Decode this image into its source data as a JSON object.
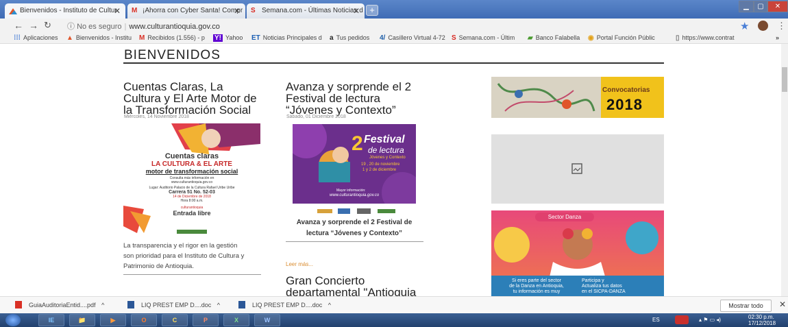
{
  "tabs": [
    {
      "title": "Bienvenidos - Instituto de Cultur",
      "icon": "cultura-favicon-icon",
      "active": true
    },
    {
      "title": "¡Ahorra con Cyber Santa! Compr",
      "icon": "gmail-icon",
      "active": false
    },
    {
      "title": "Semana.com - Últimas Noticias d",
      "icon": "semana-icon",
      "active": false
    }
  ],
  "new_tab_label": "+",
  "toolbar": {
    "security_label": "No es seguro",
    "url": "www.culturantioquia.gov.co"
  },
  "bookmarks": [
    {
      "label": "Aplicaciones",
      "icon": "apps-grid-icon"
    },
    {
      "label": "Bienvenidos - Institu",
      "icon": "cultura-favicon-icon"
    },
    {
      "label": "Recibidos (1.556) - p",
      "icon": "gmail-icon"
    },
    {
      "label": "Yahoo",
      "icon": "yahoo-icon"
    },
    {
      "label": "Noticias Principales d",
      "icon": "et-icon"
    },
    {
      "label": "Tus pedidos",
      "icon": "amazon-icon"
    },
    {
      "label": "Casillero Virtual 4-72",
      "icon": "472-icon"
    },
    {
      "label": "Semana.com - Últim",
      "icon": "semana-icon"
    },
    {
      "label": "Banco Falabella",
      "icon": "falabella-icon"
    },
    {
      "label": "Portal Función Públic",
      "icon": "funcion-publica-icon"
    },
    {
      "label": "https://www.contrat",
      "icon": "page-icon"
    }
  ],
  "page": {
    "heading": "BIENVENIDOS",
    "article1": {
      "title_lines": [
        "Cuentas Claras, La",
        "Cultura y El Arte Motor de",
        "la Transformación Social"
      ],
      "date": "Miércoles, 14 Noviembre 2018",
      "poster": {
        "line1": "Cuentas claras",
        "line2": "LA CULTURA & EL ARTE",
        "line3": "motor de transformación social",
        "line4": "Consulta más información en",
        "line5": "www.culturantioquia.gov.co",
        "line6": "Lugar: Auditorio Palacio de la Cultura Rafael Uribe Uribe",
        "line7": "Carrera 51 No. 52-03",
        "line8": "14 de Diciembre de 2018",
        "line9": "Hora 8:00 a.m.",
        "line10": "culturantioquia",
        "line11": "Entrada libre"
      },
      "body_lines": [
        "La transparencia y el rigor en la gestión",
        "son prioridad para el Instituto de Cultura y",
        "Patrimonio de Antioquia."
      ]
    },
    "article2": {
      "title_lines": [
        "Avanza y sorprende el 2",
        "Festival de lectura",
        "“Jóvenes y Contexto”"
      ],
      "date": "Sábado, 01 Diciembre 2018",
      "poster": {
        "big_number": "2",
        "line1": "Festival",
        "line2": "de lectura",
        "line3": "Jóvenes y Contexto",
        "line4": "19 , 20 de noviembre",
        "line5": "1 y 2 de diciembre",
        "line6": "Mayor información:",
        "line7": "www.culturantioquia.gov.co"
      },
      "caption_lines": [
        "Avanza y sorprende el 2 Festival de",
        "lectura “Jóvenes y Contexto”"
      ],
      "readmore": "Leer más...",
      "next_title_lines": [
        "Gran Concierto",
        "departamental \"Antioquia"
      ]
    },
    "sidebar": {
      "convocatorias_label": "Convocatorias",
      "convocatorias_year": "2018",
      "danza_tag": "Sector Danza",
      "danza_text_left": [
        "Si eres parte del sector",
        "de la Danza en Antioquia,",
        "tu información es muy"
      ],
      "danza_text_right": [
        "Participa y",
        "Actualiza tus datos",
        "en el SICPA-DANZA"
      ]
    }
  },
  "downloads": [
    {
      "name": "GuiaAuditoriaEntid....pdf",
      "icon": "pdf-file-icon"
    },
    {
      "name": "LIQ PREST EMP D....doc",
      "icon": "doc-file-icon"
    },
    {
      "name": "LIQ PREST EMP D....doc",
      "icon": "doc-file-icon"
    }
  ],
  "show_all_label": "Mostrar todo",
  "taskbar": {
    "apps": [
      "IE",
      "📁",
      "▶",
      "O",
      "C",
      "P",
      "X",
      "W"
    ],
    "language": "ES",
    "time": "02:30 p.m.",
    "date": "17/12/2018"
  },
  "colors": {
    "accent": "#4a7fd6",
    "link": "#d98b2e",
    "convocatorias_bg": "#f1c21b"
  }
}
